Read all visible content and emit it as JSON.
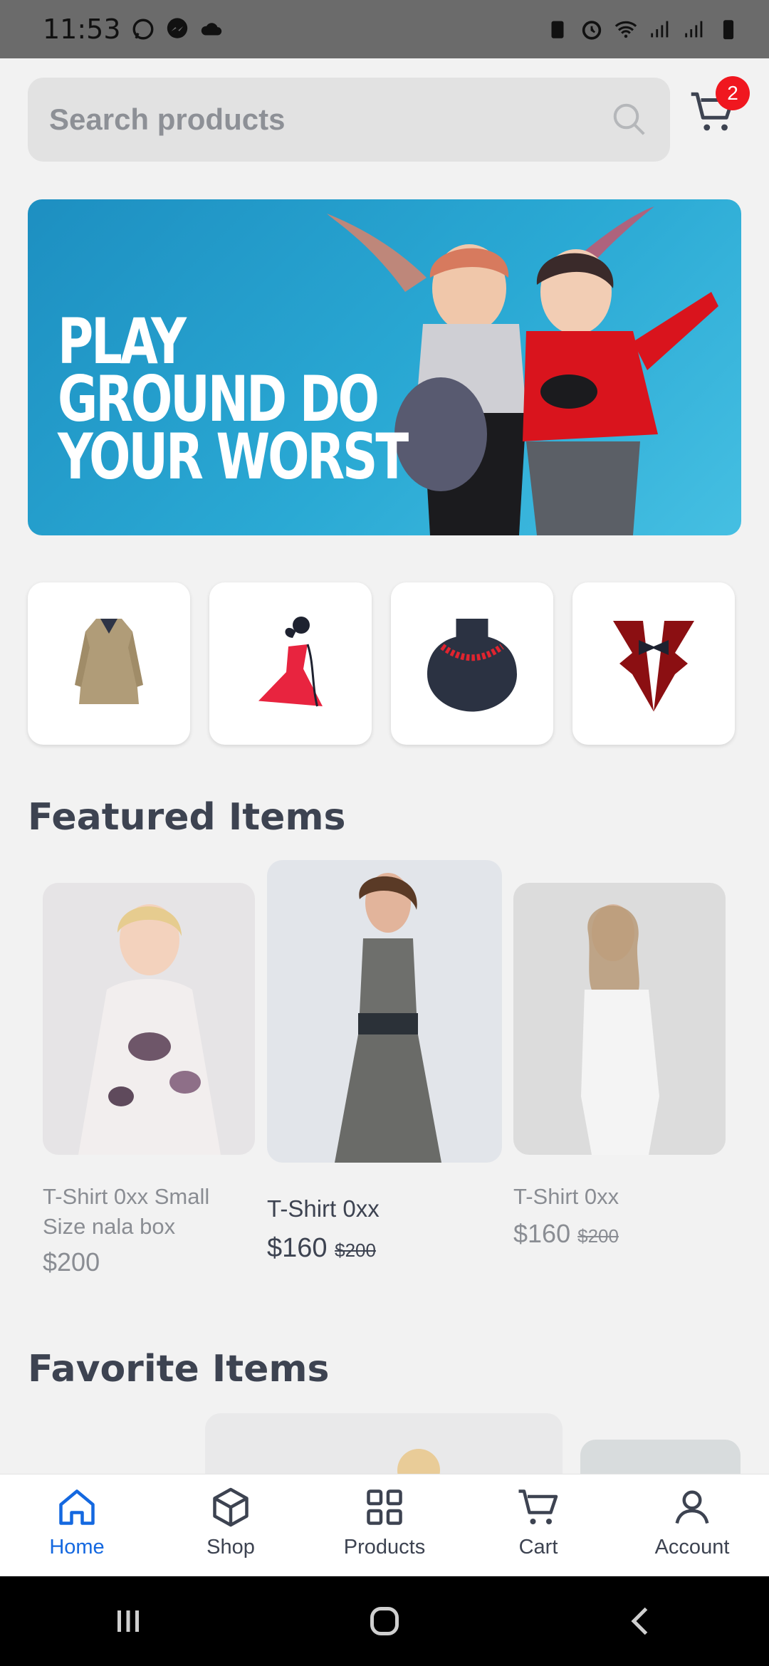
{
  "status_bar": {
    "time": "11:53"
  },
  "search": {
    "placeholder": "Search products"
  },
  "cart": {
    "badge_count": "2"
  },
  "banner": {
    "line1": "PLAY",
    "line2": "GROUND DO",
    "line3": "YOUR WORST"
  },
  "categories": [
    {
      "icon": "coat-icon"
    },
    {
      "icon": "dress-icon"
    },
    {
      "icon": "necklace-icon"
    },
    {
      "icon": "tuxedo-icon"
    }
  ],
  "featured": {
    "title": "Featured Items",
    "items": [
      {
        "name": "T-Shirt 0xx Small Size nala box",
        "price": "$200",
        "old_price": ""
      },
      {
        "name": "T-Shirt 0xx",
        "price": "$160",
        "old_price": "$200"
      },
      {
        "name": "T-Shirt 0xx",
        "price": "$160",
        "old_price": "$200"
      }
    ]
  },
  "favorites": {
    "title": "Favorite Items"
  },
  "bottom_nav": {
    "items": [
      {
        "label": "Home",
        "icon": "home-icon",
        "active": true
      },
      {
        "label": "Shop",
        "icon": "box-icon",
        "active": false
      },
      {
        "label": "Products",
        "icon": "grid-icon",
        "active": false
      },
      {
        "label": "Cart",
        "icon": "cart-icon",
        "active": false
      },
      {
        "label": "Account",
        "icon": "user-icon",
        "active": false
      }
    ]
  },
  "colors": {
    "accent": "#1468e0",
    "badge": "#f0171f",
    "banner": "#2aa9d4"
  }
}
